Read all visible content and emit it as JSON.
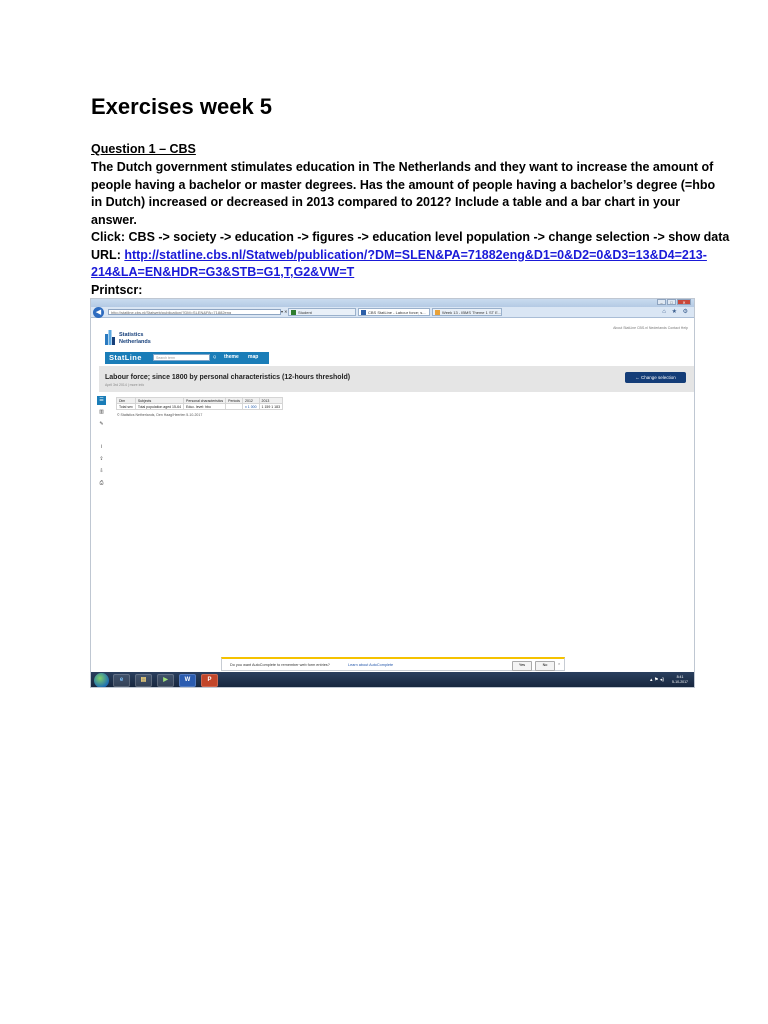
{
  "document": {
    "title": "Exercises week 5",
    "question_title": "Question 1 – CBS",
    "paragraph_lines": [
      "The Dutch government stimulates education in The Netherlands and they want to increase the amount of",
      "people having a bachelor or master degrees. Has the amount of people having a bachelor’s degree  (=hbo",
      "in Dutch) increased or decreased in 2013 compared to 2012? Include a table and a bar chart in your",
      "answer."
    ],
    "click_path": "Click: CBS -> society -> education -> figures -> education level population -> change selection -> show data",
    "url_label": "URL: ",
    "url_line1": "http://statline.cbs.nl/Statweb/publication/?DM=SLEN&PA=71882eng&D1=0&D2=0&D3=13&D4=213-",
    "url_line2": "214&LA=EN&HDR=G3&STB=G1,T,G2&VW=T",
    "printscr_label": "Printscr:"
  },
  "screenshot": {
    "window_controls": [
      "–",
      "□",
      "✕"
    ],
    "address": "http://statline.cbs.nl/Statweb/publication/?DM=SLEN&PA=71882eng",
    "address_buttons": "▾ ✕ ⟳",
    "tabs": [
      {
        "label": "Student",
        "active": false
      },
      {
        "label": "CBS StatLine - Labour force; s...",
        "active": true
      },
      {
        "label": "Week 13 - IBMS Theme 1 ST E...",
        "active": false
      }
    ],
    "ie_tools": "⌂ ★ ⚙",
    "top_links": "About StatLine  CBS.nl  Nederlands  Contact  Help",
    "logo_line1": "Statistics",
    "logo_line2": "Netherlands",
    "statline_title": "StatLine",
    "search_placeholder": "Search term",
    "search_glyph": "Q",
    "nav_theme": "theme",
    "nav_map": "map",
    "table_title": "Labour force; since 1800 by personal characteristics (12-hours threshold)",
    "table_subtitle": "April 3rd 2014 | more info",
    "change_selection": "←  Change selection",
    "rail_icons": [
      "☰",
      "▥",
      "✎",
      "i",
      "⇪",
      "⇩",
      "⎙"
    ],
    "table_header": [
      "Dim",
      "Subjects",
      "Personal characteristics",
      "Periods",
      "2012",
      "2013"
    ],
    "table_row": [
      "Total sex",
      "Total population aged 15-64",
      "Educ. level: hbo",
      "",
      "x 1 000",
      "1 159  1 183"
    ],
    "source_note": "© Statistics Netherlands, Den Haag/Heerlen 5-10-2017",
    "autocomplete_text": "Do you want AutoComplete to remember web form entries?",
    "autocomplete_link": "Learn about AutoComplete",
    "autocomplete_yes": "Yes",
    "autocomplete_no": "No",
    "autocomplete_close": "×",
    "taskbar_icons": [
      "e",
      "▤",
      "▶",
      "W",
      "P"
    ],
    "tray_icons": "▴ ⚑ ◂)",
    "tray_time": "8:41",
    "tray_date": "5-10-2017"
  }
}
